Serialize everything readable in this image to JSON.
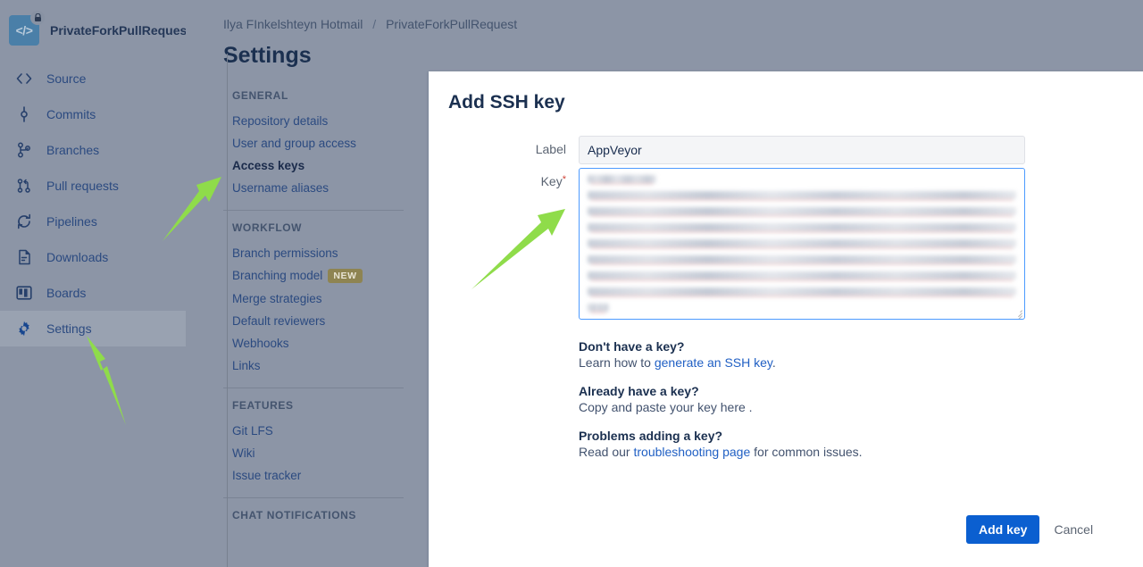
{
  "repo": {
    "name": "PrivateForkPullRequest",
    "avatar_icon": "code-brackets-icon",
    "avatar_glyph": "</>",
    "lock_icon": "lock-icon",
    "avatar_color": "#4a7fa8"
  },
  "sidebar": {
    "items": [
      {
        "label": "Source",
        "icon": "code-icon",
        "active": false
      },
      {
        "label": "Commits",
        "icon": "commit-icon",
        "active": false
      },
      {
        "label": "Branches",
        "icon": "branches-icon",
        "active": false
      },
      {
        "label": "Pull requests",
        "icon": "pull-request-icon",
        "active": false
      },
      {
        "label": "Pipelines",
        "icon": "pipelines-icon",
        "active": false
      },
      {
        "label": "Downloads",
        "icon": "downloads-icon",
        "active": false
      },
      {
        "label": "Boards",
        "icon": "boards-icon",
        "active": false
      },
      {
        "label": "Settings",
        "icon": "gear-icon",
        "active": true
      }
    ]
  },
  "breadcrumb": {
    "workspace": "Ilya FInkelshteyn Hotmail",
    "separator": "/",
    "repository": "PrivateForkPullRequest"
  },
  "page": {
    "title": "Settings"
  },
  "settings_nav": {
    "sections": [
      {
        "heading": "GENERAL",
        "items": [
          {
            "label": "Repository details",
            "current": false,
            "badge": null
          },
          {
            "label": "User and group access",
            "current": false,
            "badge": null
          },
          {
            "label": "Access keys",
            "current": true,
            "badge": null
          },
          {
            "label": "Username aliases",
            "current": false,
            "badge": null
          }
        ]
      },
      {
        "heading": "WORKFLOW",
        "items": [
          {
            "label": "Branch permissions",
            "current": false,
            "badge": null
          },
          {
            "label": "Branching model",
            "current": false,
            "badge": "NEW"
          },
          {
            "label": "Merge strategies",
            "current": false,
            "badge": null
          },
          {
            "label": "Default reviewers",
            "current": false,
            "badge": null
          },
          {
            "label": "Webhooks",
            "current": false,
            "badge": null
          },
          {
            "label": "Links",
            "current": false,
            "badge": null
          }
        ]
      },
      {
        "heading": "FEATURES",
        "items": [
          {
            "label": "Git LFS",
            "current": false,
            "badge": null
          },
          {
            "label": "Wiki",
            "current": false,
            "badge": null
          },
          {
            "label": "Issue tracker",
            "current": false,
            "badge": null
          }
        ]
      },
      {
        "heading": "CHAT NOTIFICATIONS",
        "items": []
      }
    ]
  },
  "dialog": {
    "title": "Add SSH key",
    "fields": {
      "label": {
        "label": "Label",
        "value": "AppVeyor",
        "placeholder": ""
      },
      "key": {
        "label": "Key",
        "required_marker": "*",
        "value": "",
        "placeholder": "",
        "redacted": true,
        "redacted_line_count": 9,
        "focused": true
      }
    },
    "help": [
      {
        "question": "Don't have a key?",
        "answer_prefix": "Learn how to ",
        "link": "generate an SSH key",
        "answer_suffix": "."
      },
      {
        "question": "Already have a key?",
        "answer_prefix": "Copy and paste your key here .",
        "link": "",
        "answer_suffix": ""
      },
      {
        "question": "Problems adding a key?",
        "answer_prefix": "Read our ",
        "link": "troubleshooting page",
        "answer_suffix": " for common issues."
      }
    ],
    "actions": {
      "primary": "Add key",
      "secondary": "Cancel"
    }
  },
  "annotations": {
    "arrow_color": "#8fdc4a",
    "arrows": [
      {
        "name": "arrow-to-settings",
        "points_at": "Settings"
      },
      {
        "name": "arrow-to-access-keys",
        "points_at": "Access keys"
      },
      {
        "name": "arrow-to-key-textarea",
        "points_at": "Key"
      }
    ]
  },
  "theme": {
    "page_background": "#8c95a6",
    "dialog_background": "#ffffff",
    "link_color": "#2160c4",
    "primary_button": "#0b5fd0",
    "focus_border": "#4c9aff",
    "required_star": "#d04437",
    "badge_new_bg": "#8e8452"
  }
}
